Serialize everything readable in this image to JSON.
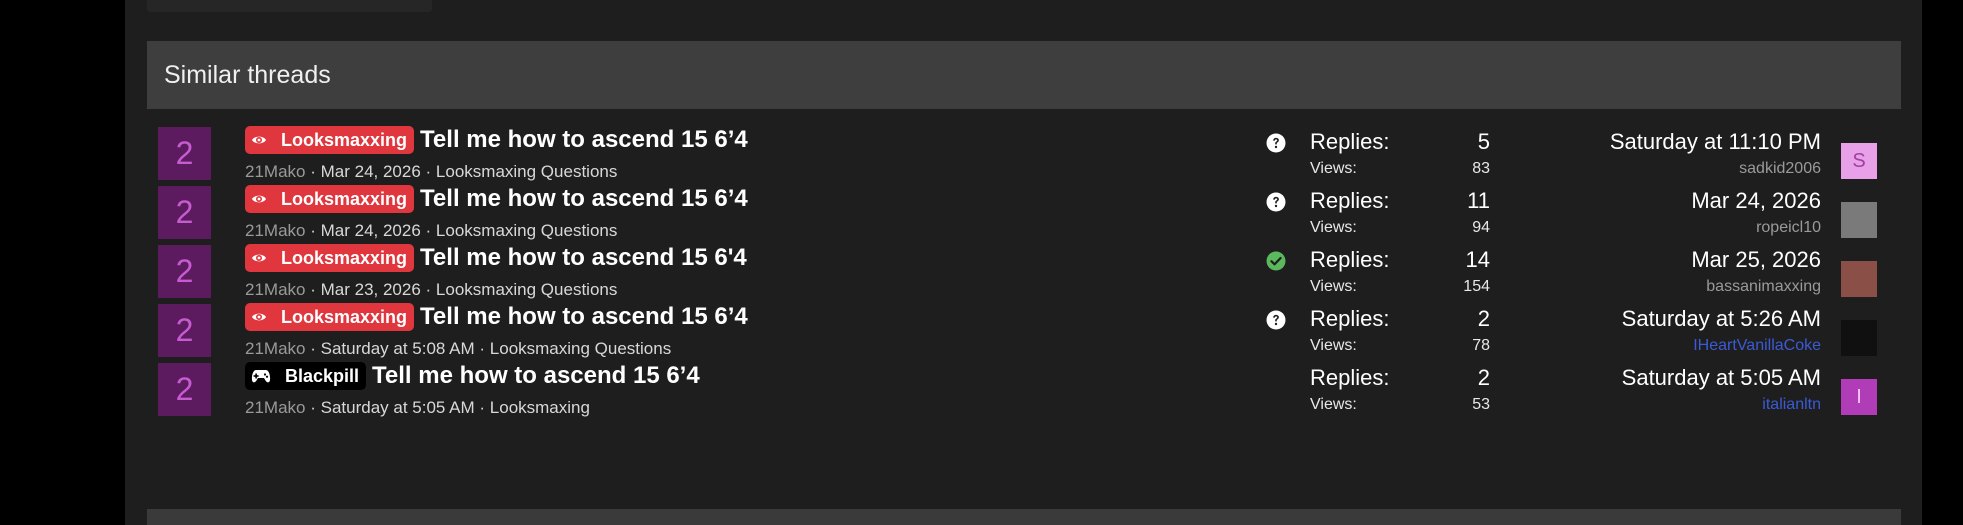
{
  "section": {
    "title": "Similar threads"
  },
  "threads": [
    {
      "prefix": "Looksmaxxing",
      "prefix_style": "red",
      "prefix_icon": "eye-icon",
      "title": "Tell me how to ascend 15 6’4",
      "author": "21Mako",
      "date": "Mar 24, 2026",
      "forum": "Looksmaxing Questions",
      "status": "question-icon",
      "replies_label": "Replies:",
      "replies": "5",
      "views_label": "Views:",
      "views": "83",
      "last_date": "Saturday at 11:10 PM",
      "last_user": "sadkid2006",
      "avatar_letter": "S",
      "avatar_bg": "#e8a0e8",
      "avatar_fg": "#a040a0"
    },
    {
      "prefix": "Looksmaxxing",
      "prefix_style": "red",
      "prefix_icon": "eye-icon",
      "title": "Tell me how to ascend 15 6’4",
      "author": "21Mako",
      "date": "Mar 24, 2026",
      "forum": "Looksmaxing Questions",
      "status": "question-icon",
      "replies_label": "Replies:",
      "replies": "11",
      "views_label": "Views:",
      "views": "94",
      "last_date": "Mar 24, 2026",
      "last_user": "ropeicl10",
      "avatar_letter": "",
      "avatar_bg": "#7a7a7a",
      "avatar_fg": "#ffffff"
    },
    {
      "prefix": "Looksmaxxing",
      "prefix_style": "red",
      "prefix_icon": "eye-icon",
      "title": "Tell me how to ascend 15 6'4",
      "author": "21Mako",
      "date": "Mar 23, 2026",
      "forum": "Looksmaxing Questions",
      "status": "check-icon",
      "replies_label": "Replies:",
      "replies": "14",
      "views_label": "Views:",
      "views": "154",
      "last_date": "Mar 25, 2026",
      "last_user": "bassanimaxxing",
      "avatar_letter": "",
      "avatar_bg": "#8a5048",
      "avatar_fg": "#ffffff"
    },
    {
      "prefix": "Looksmaxxing",
      "prefix_style": "red",
      "prefix_icon": "eye-icon",
      "title": "Tell me how to ascend 15 6’4",
      "author": "21Mako",
      "date": "Saturday at 5:08 AM",
      "forum": "Looksmaxing Questions",
      "status": "question-icon",
      "replies_label": "Replies:",
      "replies": "2",
      "views_label": "Views:",
      "views": "78",
      "last_date": "Saturday at 5:26 AM",
      "last_user": "IHeartVanillaCoke",
      "avatar_letter": "",
      "avatar_bg": "#101010",
      "avatar_fg": "#ffffff"
    },
    {
      "prefix": "Blackpill",
      "prefix_style": "black",
      "prefix_icon": "gamepad-icon",
      "title": "Tell me how to ascend 15 6’4",
      "author": "21Mako",
      "date": "Saturday at 5:05 AM",
      "forum": "Looksmaxing",
      "status": "",
      "replies_label": "Replies:",
      "replies": "2",
      "views_label": "Views:",
      "views": "53",
      "last_date": "Saturday at 5:05 AM",
      "last_user": "italianltn",
      "avatar_letter": "I",
      "avatar_bg": "#b03cb8",
      "avatar_fg": "#f4c8f4"
    }
  ],
  "avatar_number": "2",
  "colors": {
    "prefix_red": "#e0363d",
    "check_green": "#5cb85c",
    "user_link_blue": "#3b5bd6",
    "header_bg": "#3e3e3e"
  }
}
